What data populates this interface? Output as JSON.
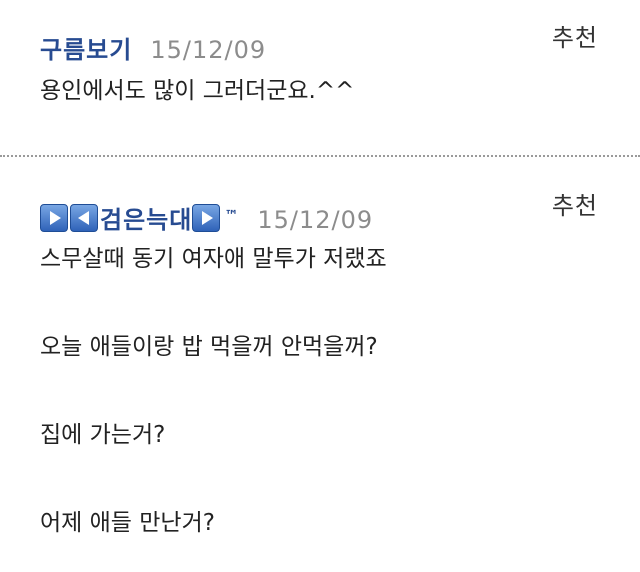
{
  "comments": [
    {
      "author": "구름보기",
      "date": "15/12/09",
      "recommend": "추천",
      "lines": [
        "용인에서도 많이 그러더군요.^^"
      ]
    },
    {
      "author_icons": [
        "play-right",
        "play-left"
      ],
      "author": "검은늑대",
      "author_suffix": "™",
      "date": "15/12/09",
      "recommend": "추천",
      "lines": [
        "스무살때 동기 여자애 말투가 저랬죠",
        "오늘 애들이랑 밥 먹을꺼 안먹을꺼?",
        "집에 가는거?",
        "어제 애들 만난거?"
      ]
    }
  ],
  "colors": {
    "author": "#274b91",
    "date": "#8c8c8c",
    "text": "#222222",
    "divider": "#9a9a9a",
    "icon": "#2f62b8"
  }
}
